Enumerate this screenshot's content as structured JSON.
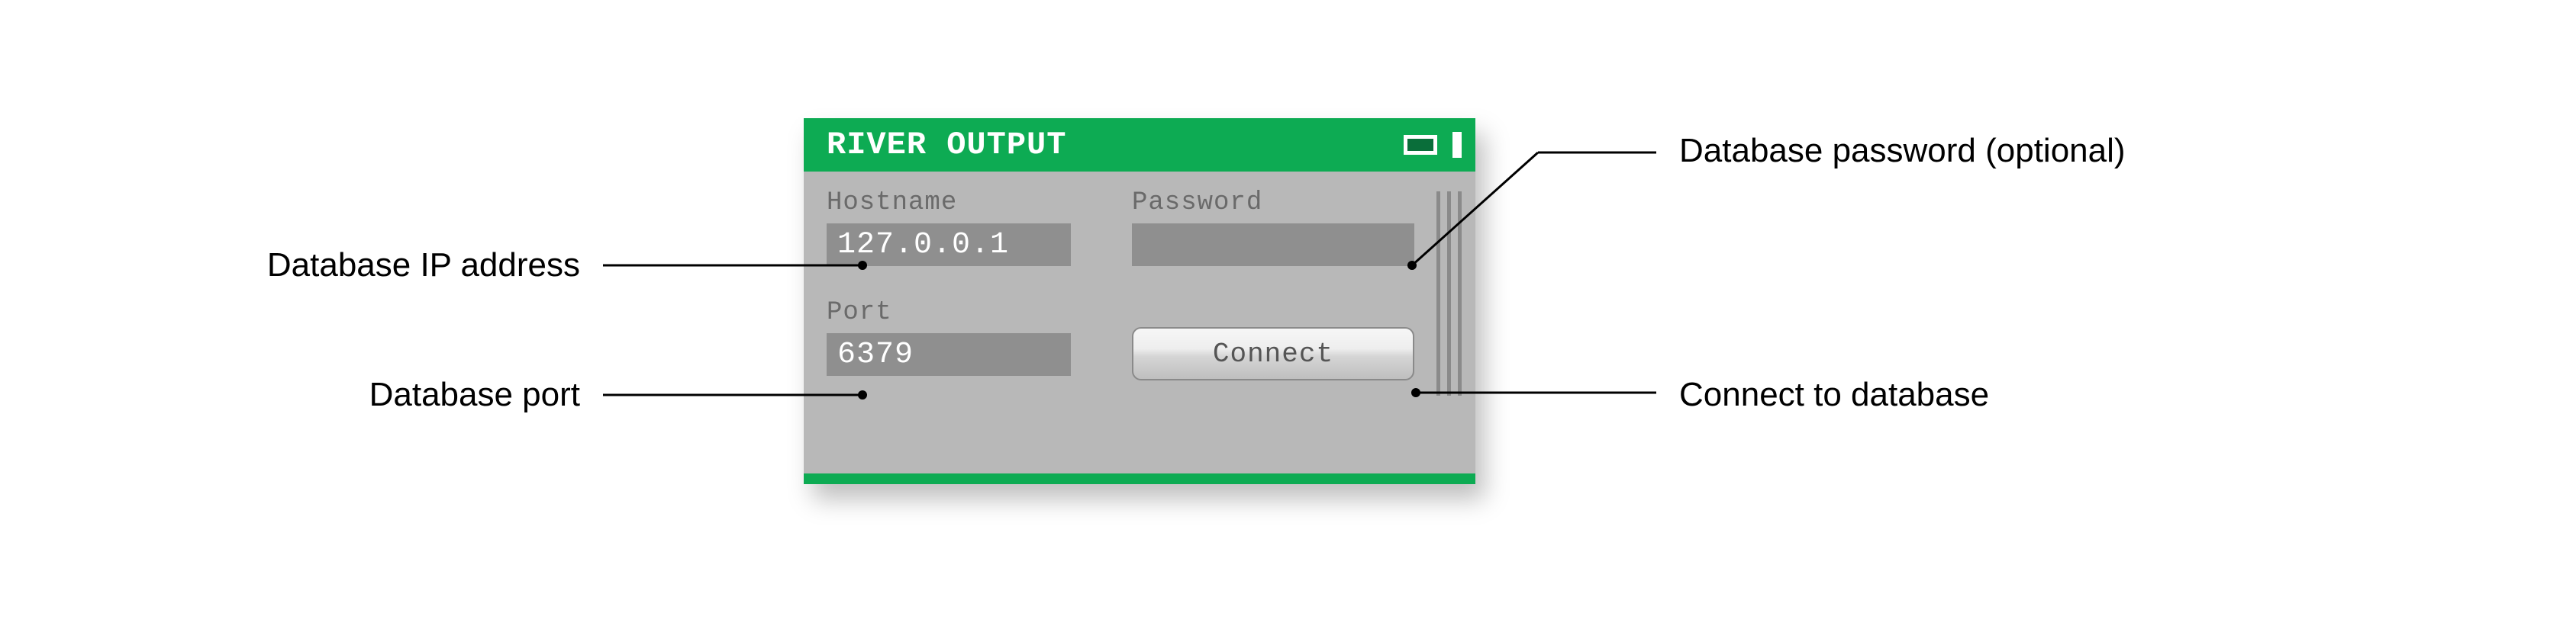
{
  "dialog": {
    "title": "RIVER OUTPUT",
    "hostname_label": "Hostname",
    "hostname_value": "127.0.0.1",
    "port_label": "Port",
    "port_value": "6379",
    "password_label": "Password",
    "password_value": "",
    "connect_label": "Connect"
  },
  "callouts": {
    "hostname": "Database IP address",
    "port": "Database port",
    "password": "Database password (optional)",
    "connect": "Connect to database"
  },
  "colors": {
    "accent": "#0dab53",
    "panel": "#b8b8b8",
    "input_bg": "#8f8f8f"
  }
}
